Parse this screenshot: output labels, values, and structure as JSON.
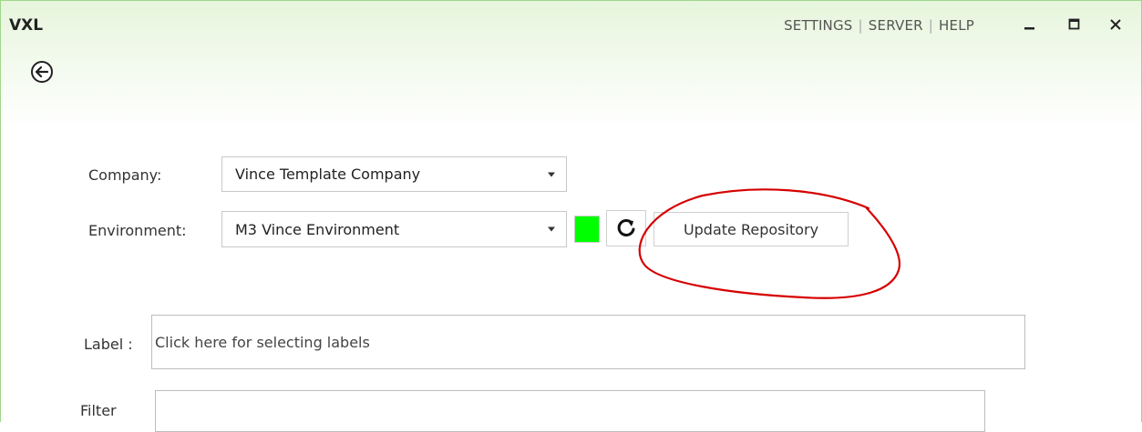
{
  "app": {
    "title": "VXL"
  },
  "topnav": {
    "settings": "SETTINGS",
    "server": "SERVER",
    "help": "HELP",
    "separator": "|"
  },
  "form": {
    "company_label": "Company:",
    "company_value": "Vince Template Company",
    "environment_label": "Environment:",
    "environment_value": "M3 Vince Environment",
    "update_button": "Update Repository",
    "label_label": "Label :",
    "label_placeholder": "Click here for selecting labels",
    "filter_label": "Filter"
  },
  "status": {
    "color": "#00ff00"
  },
  "annotation": {
    "color": "#d60000"
  }
}
